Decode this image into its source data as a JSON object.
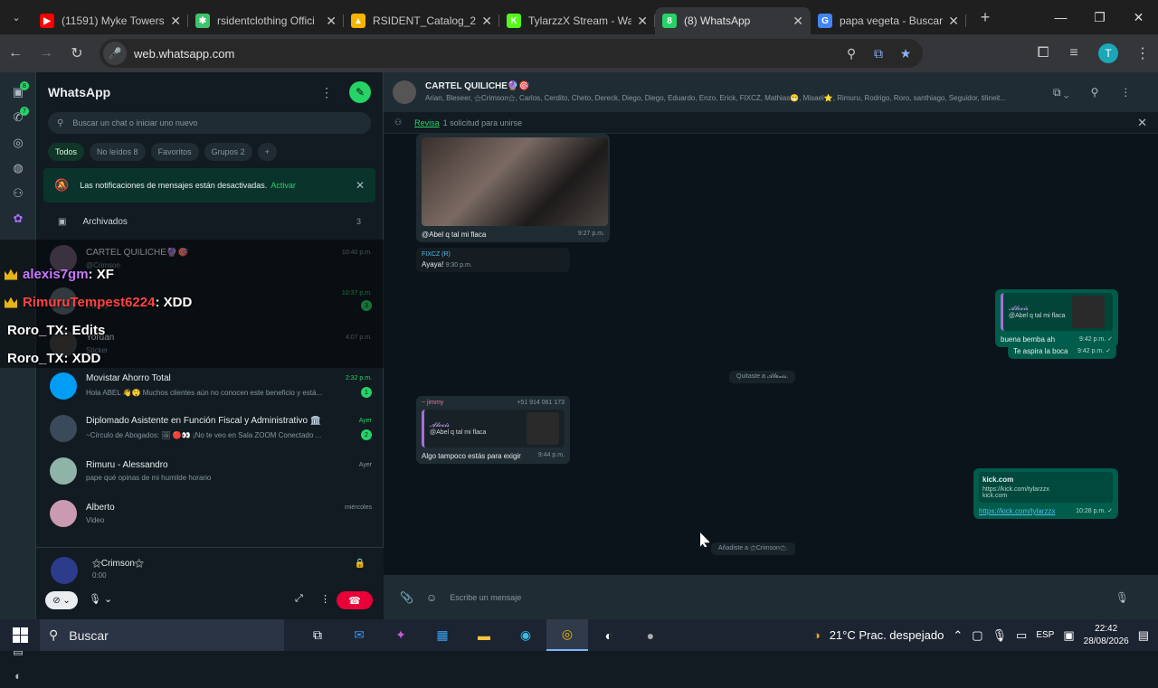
{
  "tabs": [
    {
      "title": "(11591) Myke Towers",
      "color": "#ff0000",
      "glyph": "▶",
      "active": false
    },
    {
      "title": "rsidentclothing Offici",
      "color": "#3ec46d",
      "glyph": "✱",
      "active": false
    },
    {
      "title": "RSIDENT_Catalog_20",
      "color": "#f6b400",
      "glyph": "▲",
      "active": false
    },
    {
      "title": "TylarzzX Stream - Wa",
      "color": "#53fc18",
      "glyph": "K",
      "active": false
    },
    {
      "title": "(8) WhatsApp",
      "color": "#25d366",
      "glyph": "8",
      "active": true
    },
    {
      "title": "papa vegeta - Buscar",
      "color": "#4285f4",
      "glyph": "G",
      "active": false
    }
  ],
  "browser": {
    "url": "web.whatsapp.com",
    "profile_initial": "T"
  },
  "rail": {
    "badges": [
      "8",
      "7"
    ]
  },
  "sidebar": {
    "title": "WhatsApp",
    "search_placeholder": "Buscar un chat o iniciar uno nuevo",
    "filters": [
      "Todos",
      "No leídos 8",
      "Favoritos",
      "Grupos 2",
      "+"
    ],
    "notification": {
      "text": "Las notificaciones de mensajes están desactivadas.",
      "action": "Activar"
    },
    "archived": {
      "label": "Archivados",
      "count": "3"
    },
    "chats": [
      {
        "name": "CARTEL QUILICHE🔮🎯",
        "time": "10:40 p.m.",
        "preview": "@Crimson ",
        "unread": "",
        "avatar": "#6b5b73",
        "greentime": false
      },
      {
        "name": "",
        "time": "10:37 p.m.",
        "preview": "2 fotos",
        "unread": "3",
        "avatar": "#5e6a73",
        "greentime": true
      },
      {
        "name": "Yordan",
        "time": "4:07 p.m.",
        "preview": "Sticker",
        "unread": "",
        "avatar": "#444",
        "greentime": false
      },
      {
        "name": "Movistar Ahorro Total",
        "time": "2:32 p.m.",
        "preview": "Hola ABEL 👋😲 Muchos clientes aún no conocen este beneficio y está...",
        "unread": "1",
        "avatar": "#019df4",
        "greentime": true
      },
      {
        "name": "Diplomado Asistente en Función Fiscal y Administrativo 🏛️",
        "time": "Ayer",
        "preview": "~Círculo de Abogados: 🖼 🔴👀 ¡No te veo en Sala ZOOM Conectado ...",
        "unread": "2",
        "avatar": "#3a4a5a",
        "greentime": true
      },
      {
        "name": "Rimuru - Alessandro",
        "time": "Ayer",
        "preview": "pape qué opinas de mi humilde horario",
        "unread": "",
        "avatar": "#8fb3a8",
        "greentime": false
      },
      {
        "name": "Alberto",
        "time": "miércoles",
        "preview": "Video",
        "unread": "",
        "avatar": "#c99ab0",
        "greentime": false
      }
    ]
  },
  "stream_overlay": [
    {
      "user": "alexis7gm",
      "msg": ": XF",
      "cls": "u1"
    },
    {
      "user": "RimuruTempest6224",
      "msg": ": XDD",
      "cls": "u2"
    },
    {
      "user": "Roro_TX",
      "msg": ": Edits",
      "cls": "u3"
    },
    {
      "user": "Roro_TX",
      "msg": ": XDD",
      "cls": "u3"
    }
  ],
  "call": {
    "name": "⚝Crimson⚝",
    "time": "0:00"
  },
  "conversation": {
    "group_name": "CARTEL QUILICHE🔮🎯",
    "members": "Arian, Bleseer, ⚝Crimson⚝, Carlos, Cerdito, Cheto, Dereck, Diego, Diego, Eduardo, Enzo, Erick, FIXCZ, Mathias😁, Misael⭐, Rimuru, Rodrigo, Roro, santhiago, Seguidor, tilineit...",
    "request_text": "Revisa",
    "request_link": "1 solicitud para unirse",
    "messages": {
      "m1_text": "@Abel q tal mi flaca",
      "m1_time": "9:27 p.m.",
      "m2_sender": "FIXCZ (R)",
      "m2_text": "Ayaya!",
      "m2_time": "9:30 p.m.",
      "m3_quote_author": "𝓐𝓵𝓮𝔁𝓲𝓼",
      "m3_quote": "@Abel q tal mi flaca",
      "m3_text": "buena bemba ah",
      "m3_time": "9:42 p.m. ✓",
      "m4_text": "Te aspira la boca",
      "m4_time": "9:42 p.m. ✓",
      "sys1": "Quitaste a 𝓐𝓵𝓮𝔁𝓲𝓼.",
      "m5_sender": "~ jimmy",
      "m5_phone": "+51 914 061 173",
      "m5_quote_author": "𝓐𝓵𝓮𝔁𝓲𝓼",
      "m5_quote": "@Abel q tal mi flaca",
      "m5_text": "Algo tampoco estás para exigir",
      "m5_time": "9:44 p.m.",
      "m6_title": "kick.com",
      "m6_desc": "https://kick.com/tylarzzx",
      "m6_domain": "kick.com",
      "m6_link": "https://kick.com/tylarzzx",
      "m6_time": "10:28 p.m. ✓",
      "sys2": "Añadiste a ⚝Crimson⚝."
    },
    "compose_placeholder": "Escribe un mensaje"
  },
  "taskbar": {
    "search": "Buscar",
    "weather": "21°C Prac. despejado",
    "lang": "ESP",
    "time": "22:42",
    "date": "28/08/2026"
  }
}
